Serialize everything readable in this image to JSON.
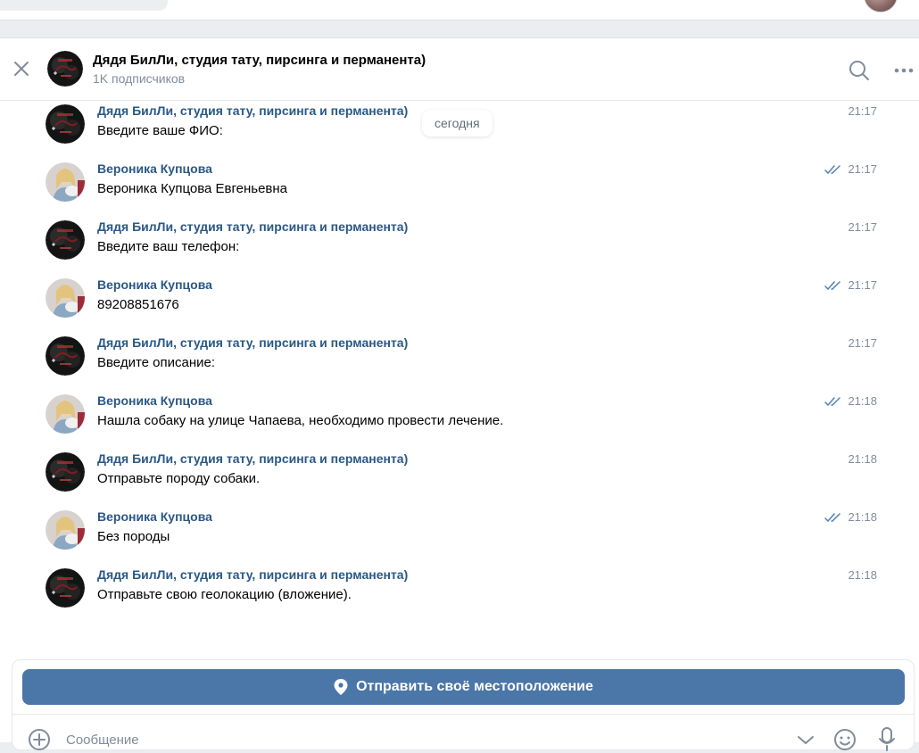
{
  "header": {
    "title": "Дядя БилЛи, студия тату, пирсинга и перманента)",
    "subtitle": "1K подписчиков"
  },
  "date_divider": "сегодня",
  "messages": [
    {
      "author": "Дядя БилЛи, студия тату, пирсинга и перманента)",
      "text": "Введите ваше ФИО:",
      "time": "21:17",
      "sender": "bot",
      "read": false
    },
    {
      "author": "Вероника Купцова",
      "text": "Вероника Купцова Евгеньевна",
      "time": "21:17",
      "sender": "user",
      "read": true
    },
    {
      "author": "Дядя БилЛи, студия тату, пирсинга и перманента)",
      "text": "Введите ваш телефон:",
      "time": "21:17",
      "sender": "bot",
      "read": false
    },
    {
      "author": "Вероника Купцова",
      "text": "89208851676",
      "time": "21:17",
      "sender": "user",
      "read": true
    },
    {
      "author": "Дядя БилЛи, студия тату, пирсинга и перманента)",
      "text": "Введите описание:",
      "time": "21:17",
      "sender": "bot",
      "read": false
    },
    {
      "author": "Вероника Купцова",
      "text": "Нашла собаку на улице Чапаева, необходимо провести лечение.",
      "time": "21:18",
      "sender": "user",
      "read": true
    },
    {
      "author": "Дядя БилЛи, студия тату, пирсинга и перманента)",
      "text": "Отправьте породу собаки.",
      "time": "21:18",
      "sender": "bot",
      "read": false
    },
    {
      "author": "Вероника Купцова",
      "text": "Без породы",
      "time": "21:18",
      "sender": "user",
      "read": true
    },
    {
      "author": "Дядя БилЛи, студия тату, пирсинга и перманента)",
      "text": "Отправьте свою геолокацию (вложение).",
      "time": "21:18",
      "sender": "bot",
      "read": false
    }
  ],
  "composer": {
    "location_button_label": "Отправить своё местоположение",
    "placeholder": "Сообщение"
  },
  "icons": {
    "close": "close-icon",
    "search": "search-icon",
    "more": "more-icon",
    "read": "double-check-icon",
    "location": "location-pin-icon",
    "attach": "plus-circle-icon",
    "keyboard": "chevron-down-icon",
    "emoji": "emoji-icon",
    "voice": "microphone-icon"
  },
  "colors": {
    "accent": "#4a76a8",
    "author": "#2a5885",
    "muted": "#818c99",
    "read_mark": "#5181b8"
  }
}
